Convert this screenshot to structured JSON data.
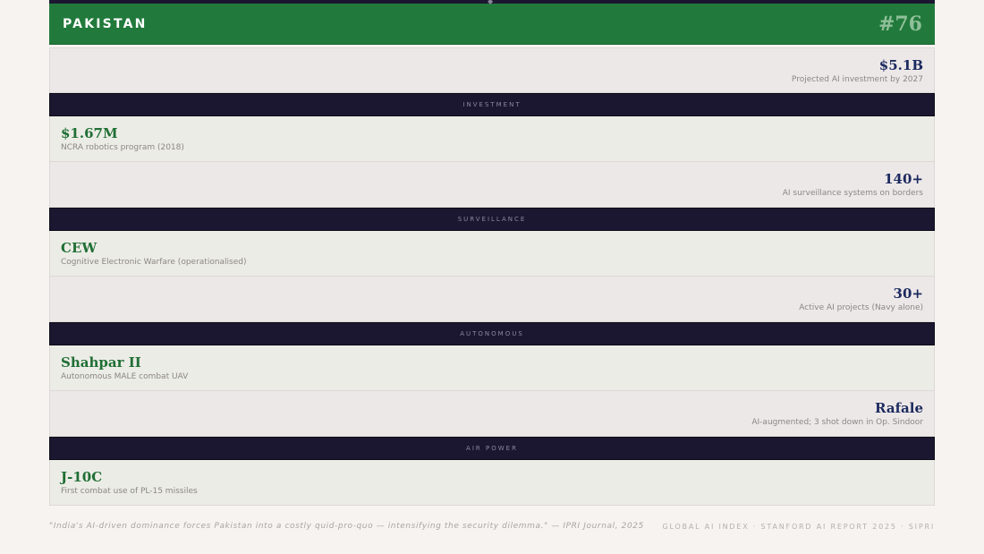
{
  "header": {
    "country": "PAKISTAN",
    "rank": "#76"
  },
  "stats": [
    {
      "value": "$5.1B",
      "label": "Projected AI investment by 2027",
      "align": "right"
    },
    {
      "section": "INVESTMENT"
    },
    {
      "value": "$1.67M",
      "label": "NCRA robotics program (2018)",
      "align": "left"
    },
    {
      "value": "140+",
      "label": "AI surveillance systems on borders",
      "align": "right"
    },
    {
      "section": "SURVEILLANCE"
    },
    {
      "value": "CEW",
      "label": "Cognitive Electronic Warfare (operationalised)",
      "align": "left"
    },
    {
      "value": "30+",
      "label": "Active AI projects (Navy alone)",
      "align": "right"
    },
    {
      "section": "AUTONOMOUS"
    },
    {
      "value": "Shahpar II",
      "label": "Autonomous MALE combat UAV",
      "align": "left"
    },
    {
      "value": "Rafale",
      "label": "AI-augmented; 3 shot down in Op. Sindoor",
      "align": "right"
    },
    {
      "section": "AIR POWER"
    },
    {
      "value": "J-10C",
      "label": "First combat use of PL-15 missiles",
      "align": "left"
    }
  ],
  "footer": {
    "quote": "\"India's AI-driven dominance forces Pakistan into a costly quid-pro-quo — intensifying the security dilemma.\" — IPRI Journal, 2025",
    "sources": "GLOBAL AI INDEX · STANFORD AI REPORT 2025 · SIPRI"
  },
  "colors": {
    "header_green": "#217a3c",
    "section_dark": "#1b1730",
    "value_navy": "#1b2a5e",
    "value_green": "#1f6f34"
  }
}
